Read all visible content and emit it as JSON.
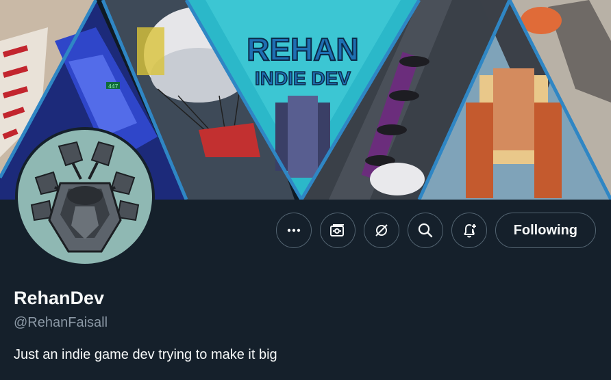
{
  "banner": {
    "title_line1": "REHAN",
    "title_line2": "INDIE DEV",
    "tag": "447"
  },
  "profile": {
    "display_name": "RehanDev",
    "handle": "@RehanFaisall",
    "bio": "Just an indie game dev trying to make it big"
  },
  "actions": {
    "more_label": "More",
    "subscribe_label": "Subscribe",
    "grok_label": "Grok actions",
    "search_label": "Search",
    "notify_label": "Turn on post notifications",
    "follow_label": "Following"
  },
  "icons": [
    "more-icon",
    "subscribe-icon",
    "grok-icon",
    "search-icon",
    "bell-plus-icon"
  ],
  "colors": {
    "background": "#15202b",
    "text": "#f7f9f9",
    "muted": "#8b98a5",
    "border": "#536471",
    "banner_accent": "#2bb8c9",
    "banner_divider": "#2f86c4"
  }
}
